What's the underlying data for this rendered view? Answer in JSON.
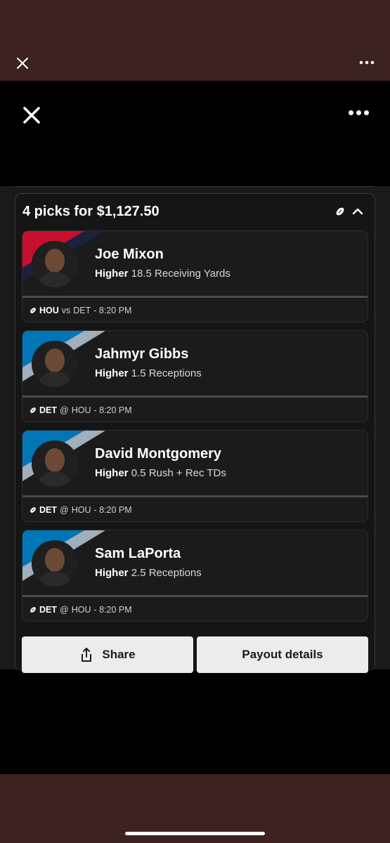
{
  "outer": {
    "close_icon": "close-icon",
    "more_icon": "more-icon"
  },
  "header": {
    "close_icon": "close-icon",
    "more_icon": "more-icon"
  },
  "card": {
    "title": "4 picks for $1,127.50",
    "football_icon": "football-icon",
    "collapse_icon": "chevron-up-icon"
  },
  "picks": [
    {
      "name": "Joe Mixon",
      "direction": "Higher",
      "stat": "18.5 Receiving Yards",
      "team": "HOU",
      "sep": "vs",
      "opp": "DET",
      "time": "- 8:20 PM",
      "stripe_colors": [
        "#c8102e",
        "#0b2240"
      ]
    },
    {
      "name": "Jahmyr Gibbs",
      "direction": "Higher",
      "stat": "1.5 Receptions",
      "team": "DET",
      "sep": "@",
      "opp": "HOU",
      "time": "- 8:20 PM",
      "stripe_colors": [
        "#0076b6",
        "#b0b7bc"
      ]
    },
    {
      "name": "David Montgomery",
      "direction": "Higher",
      "stat": "0.5 Rush + Rec TDs",
      "team": "DET",
      "sep": "@",
      "opp": "HOU",
      "time": "- 8:20 PM",
      "stripe_colors": [
        "#0076b6",
        "#b0b7bc"
      ]
    },
    {
      "name": "Sam LaPorta",
      "direction": "Higher",
      "stat": "2.5 Receptions",
      "team": "DET",
      "sep": "@",
      "opp": "HOU",
      "time": "- 8:20 PM",
      "stripe_colors": [
        "#0076b6",
        "#b0b7bc"
      ]
    }
  ],
  "actions": {
    "share_label": "Share",
    "share_icon": "share-icon",
    "payout_label": "Payout details"
  },
  "colors": {
    "outer_bg": "#3d2320",
    "screen_bg": "#000000",
    "card_bg": "#151515",
    "button_bg": "#ececec"
  }
}
